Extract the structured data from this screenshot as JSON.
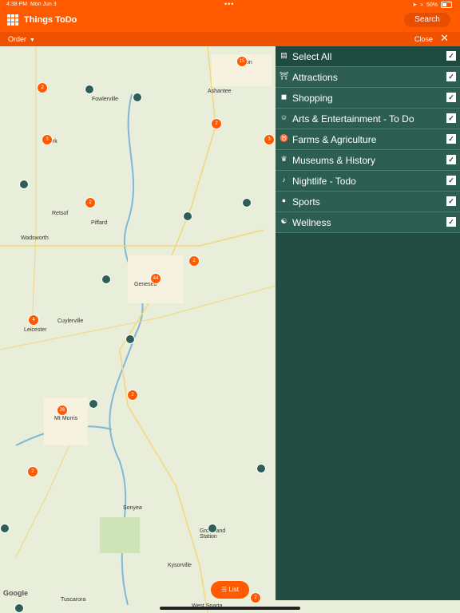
{
  "status": {
    "time": "4:38 PM",
    "date": "Mon Jun 3",
    "battery": "50%"
  },
  "header": {
    "title": "Things ToDo",
    "search_label": "Search"
  },
  "subbar": {
    "order_label": "Order",
    "close_label": "Close"
  },
  "map": {
    "google_label": "Google",
    "towns": [
      "Avon",
      "Fowlerville",
      "Ashantee",
      "York",
      "Retsof",
      "Piffard",
      "Wadsworth",
      "Geneseo",
      "Cuylerville",
      "Leicester",
      "Mt Morris",
      "Sonyea",
      "Groveland Station",
      "Kysorville",
      "Tuscarora",
      "West Sparta"
    ],
    "clusters": [
      "15",
      "2",
      "2",
      "3",
      "3",
      "2",
      "2",
      "44",
      "4",
      "2",
      "26",
      "2",
      "2"
    ],
    "list_label": "List"
  },
  "filters": {
    "items": [
      {
        "label": "Select All",
        "icon": "list-icon",
        "checked": true
      },
      {
        "label": "Attractions",
        "icon": "attractions-icon",
        "checked": true
      },
      {
        "label": "Shopping",
        "icon": "shopping-bag-icon",
        "checked": true
      },
      {
        "label": "Arts & Entertainment - To Do",
        "icon": "theater-masks-icon",
        "checked": true
      },
      {
        "label": "Farms & Agriculture",
        "icon": "cow-icon",
        "checked": true
      },
      {
        "label": "Museums & History",
        "icon": "museum-icon",
        "checked": true
      },
      {
        "label": "Nightlife - Todo",
        "icon": "nightlife-icon",
        "checked": true
      },
      {
        "label": "Sports",
        "icon": "sports-icon",
        "checked": true
      },
      {
        "label": "Wellness",
        "icon": "wellness-icon",
        "checked": true
      }
    ]
  },
  "colors": {
    "brand": "#ff5a00",
    "panel": "#234d43",
    "row": "#2d5e52"
  }
}
